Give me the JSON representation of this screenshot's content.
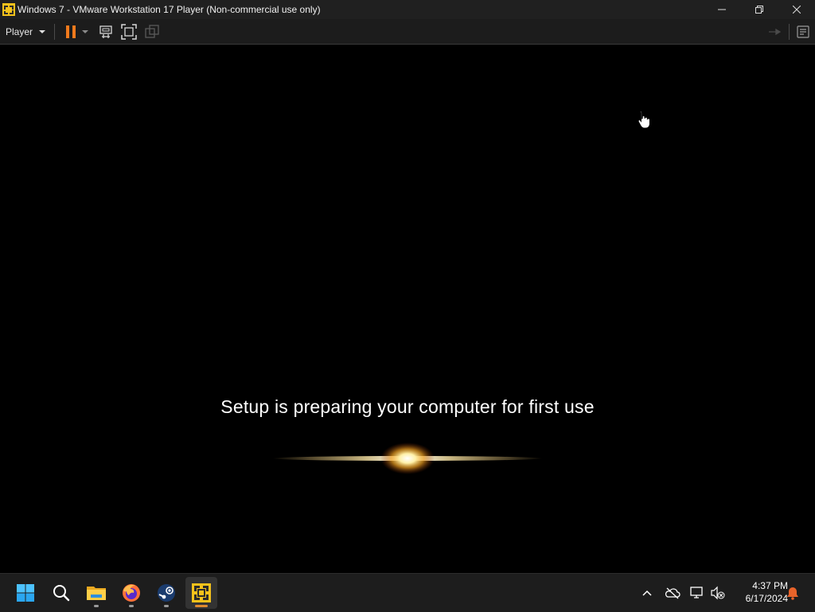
{
  "window": {
    "title": "Windows 7 - VMware Workstation 17 Player (Non-commercial use only)",
    "controls": {
      "minimize": "─",
      "restore": "❐",
      "close": "✕"
    }
  },
  "toolbar": {
    "player_menu_label": "Player",
    "buttons": [
      "pause-icon",
      "pause-dropdown",
      "send-ctrl-alt-del-icon",
      "fullscreen-icon",
      "unity-icon"
    ],
    "right_buttons": [
      "removable-devices-icon",
      "message-log-icon"
    ]
  },
  "vm": {
    "setup_message": "Setup is preparing your computer for first use"
  },
  "taskbar": {
    "apps": [
      "start-icon",
      "search-icon",
      "file-explorer-icon",
      "firefox-icon",
      "steam-icon",
      "vmware-icon"
    ],
    "tray": [
      "show-hidden-icons-chevron",
      "onedrive-offline-icon",
      "network-icon",
      "volume-muted-icon",
      "notification-bell-icon"
    ],
    "clock_time": "4:37 PM",
    "clock_date": "6/17/2024"
  },
  "colors": {
    "titlebar_bg": "#202020",
    "toolbar_bg": "#1c1c1c",
    "pause_orange": "#f07a1c",
    "vmware_yellow": "#f5c21b",
    "notification_orange": "#e8632a",
    "taskbar_bg": "#1d1d1d"
  }
}
